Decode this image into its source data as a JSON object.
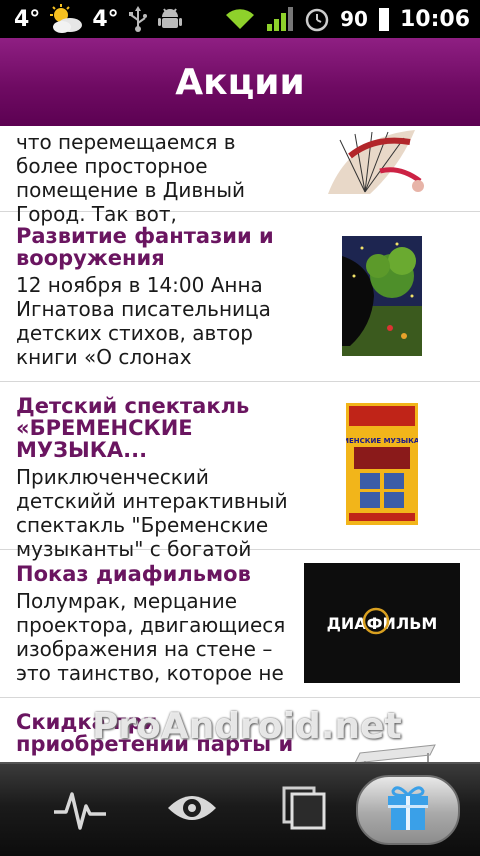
{
  "status_bar": {
    "temp_1": "4°",
    "temp_2": "4°",
    "battery": "90",
    "time": "10:06"
  },
  "header": {
    "title": "Акции"
  },
  "items": [
    {
      "title": "",
      "desc": "что перемещаемся в более просторное помещение в Дивный Город. Так вот,"
    },
    {
      "title": "Развитие фантазии и вооружения",
      "desc": "12 ноября в 14:00 Анна Игнатова писательница детских стихов, автор книги «О слонах"
    },
    {
      "title": "Детский спектакль «БРЕМЕНСКИЕ МУЗЫКА...",
      "desc": "Приключенческий детскийй интерактивный спектакль \"Бременские музыканты\" с богатой"
    },
    {
      "title": "Показ диафильмов",
      "desc": "Полумрак, мерцание проектора, двигающиеся изображения на стене – это таинство, которое не"
    },
    {
      "title": "Скидка при приобретении парты и ...",
      "desc": ""
    }
  ],
  "thumbs": {
    "diafilm_logo": "ДИАФИЛЬМ",
    "poster_title": "БРЕМЕНСКИЕ МУЗЫКАНТЫ"
  },
  "watermark": "ProAndroid.net",
  "bottom_nav": [
    {
      "icon": "pulse-icon"
    },
    {
      "icon": "eye-icon"
    },
    {
      "icon": "pages-icon"
    },
    {
      "icon": "gift-icon",
      "selected": true
    }
  ],
  "colors": {
    "header_purple": "#6f0b63",
    "title_purple": "#6a1560",
    "gift_blue": "#3aa0e8"
  }
}
